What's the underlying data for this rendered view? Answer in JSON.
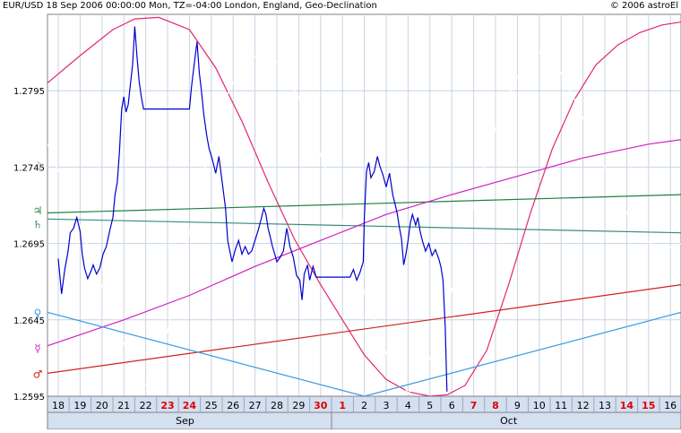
{
  "header": {
    "left": "EUR/USD  18 Sep 2006 00:00:00 Mon, TZ=-04:00 London, England, Geo-Declination",
    "right": "© 2006 astroEl"
  },
  "chart_data": {
    "type": "line",
    "title": "EUR/USD",
    "ylim": [
      1.2595,
      1.2845
    ],
    "y_ticks": [
      "1.2795",
      "1.2745",
      "1.2695",
      "1.2645",
      "1.2595"
    ],
    "grid": true,
    "colors": {
      "background": "#ffffff",
      "axis_panel": "#d4dff0",
      "grid": "#c8d4e4",
      "price": "#0000cc",
      "weekend_label": "#dd0000"
    },
    "x_days": [
      {
        "label": "18",
        "weekend": false
      },
      {
        "label": "19",
        "weekend": false
      },
      {
        "label": "20",
        "weekend": false
      },
      {
        "label": "21",
        "weekend": false
      },
      {
        "label": "22",
        "weekend": false
      },
      {
        "label": "23",
        "weekend": true
      },
      {
        "label": "24",
        "weekend": true
      },
      {
        "label": "25",
        "weekend": false
      },
      {
        "label": "26",
        "weekend": false
      },
      {
        "label": "27",
        "weekend": false
      },
      {
        "label": "28",
        "weekend": false
      },
      {
        "label": "29",
        "weekend": false
      },
      {
        "label": "30",
        "weekend": true
      },
      {
        "label": "1",
        "weekend": true
      },
      {
        "label": "2",
        "weekend": false
      },
      {
        "label": "3",
        "weekend": false
      },
      {
        "label": "4",
        "weekend": false
      },
      {
        "label": "5",
        "weekend": false
      },
      {
        "label": "6",
        "weekend": false
      },
      {
        "label": "7",
        "weekend": true
      },
      {
        "label": "8",
        "weekend": true
      },
      {
        "label": "9",
        "weekend": false
      },
      {
        "label": "10",
        "weekend": false
      },
      {
        "label": "11",
        "weekend": false
      },
      {
        "label": "12",
        "weekend": false
      },
      {
        "label": "13",
        "weekend": false
      },
      {
        "label": "14",
        "weekend": true
      },
      {
        "label": "15",
        "weekend": true
      },
      {
        "label": "16",
        "weekend": false
      }
    ],
    "month_labels": [
      {
        "label": "Sep",
        "day_index": 5.8
      },
      {
        "label": "Oct",
        "day_index": 20.6
      }
    ],
    "month_boundary_day_index": 12.5,
    "price_series": [
      [
        0,
        1.2685
      ],
      [
        0.15,
        1.2662
      ],
      [
        0.3,
        1.2678
      ],
      [
        0.45,
        1.269
      ],
      [
        0.55,
        1.2702
      ],
      [
        0.7,
        1.2705
      ],
      [
        0.85,
        1.2712
      ],
      [
        1.0,
        1.2703
      ],
      [
        1.1,
        1.2688
      ],
      [
        1.2,
        1.2679
      ],
      [
        1.35,
        1.2672
      ],
      [
        1.5,
        1.2677
      ],
      [
        1.6,
        1.2681
      ],
      [
        1.75,
        1.2675
      ],
      [
        1.9,
        1.2679
      ],
      [
        2.05,
        1.2688
      ],
      [
        2.2,
        1.2693
      ],
      [
        2.35,
        1.2703
      ],
      [
        2.5,
        1.2712
      ],
      [
        2.6,
        1.2727
      ],
      [
        2.7,
        1.2735
      ],
      [
        2.8,
        1.2755
      ],
      [
        2.9,
        1.2783
      ],
      [
        3.0,
        1.2791
      ],
      [
        3.1,
        1.2781
      ],
      [
        3.2,
        1.2786
      ],
      [
        3.3,
        1.2799
      ],
      [
        3.4,
        1.2812
      ],
      [
        3.5,
        1.2837
      ],
      [
        3.6,
        1.2818
      ],
      [
        3.7,
        1.2801
      ],
      [
        3.8,
        1.2791
      ],
      [
        3.9,
        1.2783
      ],
      [
        4.0,
        1.2783
      ],
      [
        4.5,
        1.2783
      ],
      [
        5.0,
        1.2783
      ],
      [
        5.5,
        1.2783
      ],
      [
        6.0,
        1.2783
      ],
      [
        6.1,
        1.2798
      ],
      [
        6.25,
        1.2816
      ],
      [
        6.35,
        1.2827
      ],
      [
        6.45,
        1.2807
      ],
      [
        6.55,
        1.2795
      ],
      [
        6.65,
        1.278
      ],
      [
        6.8,
        1.2765
      ],
      [
        6.9,
        1.2757
      ],
      [
        7.05,
        1.275
      ],
      [
        7.2,
        1.2741
      ],
      [
        7.35,
        1.2752
      ],
      [
        7.5,
        1.2735
      ],
      [
        7.65,
        1.2718
      ],
      [
        7.75,
        1.2697
      ],
      [
        7.85,
        1.269
      ],
      [
        7.95,
        1.2683
      ],
      [
        8.1,
        1.2691
      ],
      [
        8.25,
        1.2697
      ],
      [
        8.4,
        1.2688
      ],
      [
        8.55,
        1.2693
      ],
      [
        8.7,
        1.2688
      ],
      [
        8.85,
        1.269
      ],
      [
        9.0,
        1.2697
      ],
      [
        9.15,
        1.2704
      ],
      [
        9.3,
        1.2712
      ],
      [
        9.4,
        1.2718
      ],
      [
        9.5,
        1.2714
      ],
      [
        9.6,
        1.2705
      ],
      [
        9.7,
        1.2699
      ],
      [
        9.8,
        1.2693
      ],
      [
        9.9,
        1.2688
      ],
      [
        10.0,
        1.2683
      ],
      [
        10.15,
        1.2686
      ],
      [
        10.3,
        1.269
      ],
      [
        10.45,
        1.2705
      ],
      [
        10.6,
        1.2693
      ],
      [
        10.75,
        1.2686
      ],
      [
        10.9,
        1.2674
      ],
      [
        11.05,
        1.2671
      ],
      [
        11.15,
        1.2658
      ],
      [
        11.25,
        1.2675
      ],
      [
        11.4,
        1.2681
      ],
      [
        11.5,
        1.2671
      ],
      [
        11.65,
        1.268
      ],
      [
        11.8,
        1.2673
      ],
      [
        12.0,
        1.2673
      ],
      [
        12.5,
        1.2673
      ],
      [
        13.0,
        1.2673
      ],
      [
        13.35,
        1.2673
      ],
      [
        13.5,
        1.2678
      ],
      [
        13.65,
        1.2671
      ],
      [
        13.8,
        1.2676
      ],
      [
        13.95,
        1.2683
      ],
      [
        14.0,
        1.2712
      ],
      [
        14.1,
        1.2742
      ],
      [
        14.2,
        1.2748
      ],
      [
        14.3,
        1.2738
      ],
      [
        14.45,
        1.2742
      ],
      [
        14.6,
        1.2752
      ],
      [
        14.7,
        1.2746
      ],
      [
        14.85,
        1.274
      ],
      [
        15.0,
        1.2732
      ],
      [
        15.15,
        1.2741
      ],
      [
        15.3,
        1.2727
      ],
      [
        15.4,
        1.2721
      ],
      [
        15.5,
        1.2715
      ],
      [
        15.6,
        1.2706
      ],
      [
        15.7,
        1.2698
      ],
      [
        15.8,
        1.2681
      ],
      [
        15.9,
        1.2688
      ],
      [
        16.0,
        1.2697
      ],
      [
        16.1,
        1.2708
      ],
      [
        16.2,
        1.2714
      ],
      [
        16.35,
        1.2707
      ],
      [
        16.45,
        1.2712
      ],
      [
        16.55,
        1.2703
      ],
      [
        16.65,
        1.2697
      ],
      [
        16.8,
        1.269
      ],
      [
        16.95,
        1.2695
      ],
      [
        17.1,
        1.2687
      ],
      [
        17.25,
        1.2691
      ],
      [
        17.4,
        1.2685
      ],
      [
        17.5,
        1.268
      ],
      [
        17.6,
        1.2671
      ],
      [
        17.7,
        1.264
      ],
      [
        17.78,
        1.2598
      ]
    ],
    "overlay_series": [
      {
        "color": "#e0286e",
        "points": [
          [
            -0.5,
            1.28
          ],
          [
            1.0,
            1.2818
          ],
          [
            2.5,
            1.2835
          ],
          [
            3.5,
            1.2842
          ],
          [
            4.6,
            1.2843
          ],
          [
            6.0,
            1.2835
          ],
          [
            7.2,
            1.281
          ],
          [
            8.4,
            1.2775
          ],
          [
            9.6,
            1.2735
          ],
          [
            10.8,
            1.2698
          ],
          [
            12.0,
            1.2668
          ],
          [
            13.0,
            1.2645
          ],
          [
            14.0,
            1.2622
          ],
          [
            15.0,
            1.2606
          ],
          [
            16.0,
            1.2598
          ],
          [
            17.0,
            1.2595
          ],
          [
            17.8,
            1.2596
          ],
          [
            18.6,
            1.2602
          ],
          [
            19.6,
            1.2625
          ],
          [
            20.6,
            1.2668
          ],
          [
            21.6,
            1.2715
          ],
          [
            22.6,
            1.2757
          ],
          [
            23.6,
            1.2789
          ],
          [
            24.6,
            1.2812
          ],
          [
            25.6,
            1.2825
          ],
          [
            26.6,
            1.2833
          ],
          [
            27.6,
            1.2838
          ],
          [
            28.5,
            1.284
          ]
        ]
      },
      {
        "color": "#ffffff",
        "points": [
          [
            -0.5,
            1.276
          ],
          [
            0.6,
            1.2722
          ],
          [
            1.6,
            1.2683
          ],
          [
            2.6,
            1.2644
          ],
          [
            3.6,
            1.2608
          ],
          [
            4.2,
            1.26
          ],
          [
            4.8,
            1.2625
          ],
          [
            5.8,
            1.269
          ],
          [
            6.8,
            1.275
          ],
          [
            7.8,
            1.2795
          ],
          [
            8.6,
            1.2815
          ],
          [
            9.4,
            1.282
          ],
          [
            10.2,
            1.2812
          ],
          [
            11.2,
            1.2785
          ],
          [
            12.2,
            1.2745
          ],
          [
            13.2,
            1.27
          ],
          [
            14.2,
            1.2654
          ],
          [
            15.2,
            1.2616
          ],
          [
            16.0,
            1.2597
          ],
          [
            16.6,
            1.2605
          ],
          [
            17.4,
            1.2634
          ],
          [
            18.2,
            1.2675
          ],
          [
            19.2,
            1.273
          ],
          [
            20.2,
            1.278
          ],
          [
            21.2,
            1.281
          ],
          [
            22.0,
            1.282
          ],
          [
            22.8,
            1.2812
          ],
          [
            23.6,
            1.279
          ],
          [
            24.6,
            1.2758
          ],
          [
            25.6,
            1.2725
          ],
          [
            26.6,
            1.27
          ],
          [
            27.6,
            1.269
          ],
          [
            28.5,
            1.2695
          ]
        ]
      },
      {
        "color": "#208040",
        "points": [
          [
            -0.5,
            1.2715
          ],
          [
            28.5,
            1.2727
          ]
        ]
      },
      {
        "color": "#3a8a7a",
        "points": [
          [
            -0.5,
            1.2711
          ],
          [
            28.5,
            1.2702
          ]
        ]
      },
      {
        "color": "#d020c0",
        "points": [
          [
            -0.5,
            1.2628
          ],
          [
            3.0,
            1.2645
          ],
          [
            6.0,
            1.2661
          ],
          [
            9.0,
            1.268
          ],
          [
            12.0,
            1.2697
          ],
          [
            15.0,
            1.2714
          ],
          [
            18.0,
            1.2727
          ],
          [
            21.0,
            1.2739
          ],
          [
            24.0,
            1.2751
          ],
          [
            27.0,
            1.276
          ],
          [
            28.5,
            1.2763
          ]
        ]
      },
      {
        "color": "#d02020",
        "points": [
          [
            -0.5,
            1.261
          ],
          [
            28.5,
            1.2668
          ]
        ]
      },
      {
        "color": "#3a9ae0",
        "points": [
          [
            -0.5,
            1.265
          ],
          [
            14.0,
            1.2595
          ],
          [
            28.5,
            1.265
          ]
        ]
      }
    ],
    "planet_glyphs": [
      {
        "symbol": "☽",
        "color": "#ffffff",
        "y": 1.2746
      },
      {
        "symbol": "♃",
        "color": "#208040",
        "y": 1.2717
      },
      {
        "symbol": "♄",
        "color": "#3a8a7a",
        "y": 1.2708
      },
      {
        "symbol": "♀",
        "color": "#3a9ae0",
        "y": 1.265
      },
      {
        "symbol": "☿",
        "color": "#d020c0",
        "y": 1.2627
      },
      {
        "symbol": "♂",
        "color": "#d02020",
        "y": 1.261
      }
    ]
  }
}
